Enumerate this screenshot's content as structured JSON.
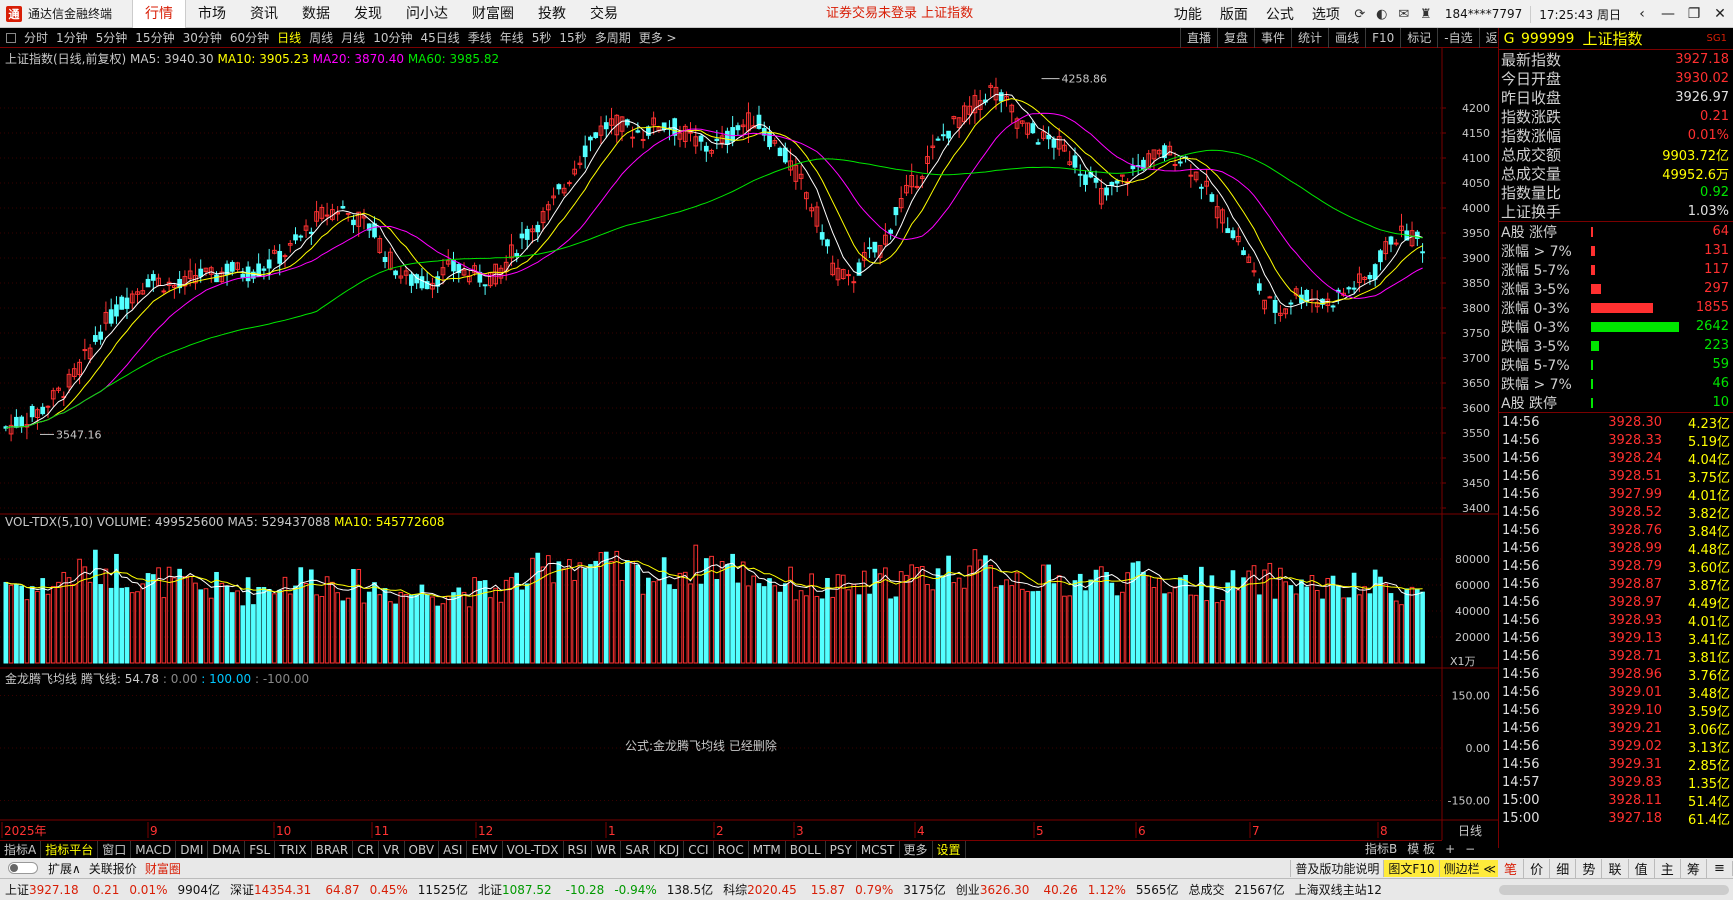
{
  "app": {
    "title": "通达信金融终端",
    "logo_glyph": "通"
  },
  "menu": [
    {
      "label": "行情",
      "active": true
    },
    {
      "label": "市场"
    },
    {
      "label": "资讯"
    },
    {
      "label": "数据"
    },
    {
      "label": "发现"
    },
    {
      "label": "问小达"
    },
    {
      "label": "财富圈"
    },
    {
      "label": "投教"
    },
    {
      "label": "交易"
    }
  ],
  "top_message": "证券交易未登录  上证指数",
  "top_right": {
    "items": [
      "功能",
      "版面",
      "公式",
      "选项"
    ],
    "account": "184****7797",
    "clock": "17:25:43 周日",
    "icons": [
      "refresh-icon",
      "user-icon",
      "message-icon",
      "shirt-icon"
    ]
  },
  "period_bar": [
    "分时",
    "1分钟",
    "5分钟",
    "15分钟",
    "30分钟",
    "60分钟",
    "日线",
    "周线",
    "月线",
    "10分钟",
    "45日线",
    "季线",
    "年线",
    "5秒",
    "15秒",
    "多周期",
    "更多 >"
  ],
  "period_active": "日线",
  "chart_buttons": [
    "直播",
    "复盘",
    "事件",
    "统计",
    "画线",
    "F10",
    "标记",
    "-自选",
    "返回"
  ],
  "legend_main": {
    "name": "上证指数(日线,前复权)",
    "ma5": "MA5: 3940.30",
    "ma10": "MA10: 3905.23",
    "ma20": "MA20: 3870.40",
    "ma60": "MA60: 3985.82"
  },
  "legend_vol": {
    "name": "VOL-TDX(5,10)",
    "volume": "VOLUME: 499525600",
    "ma5": "MA5: 529437088",
    "ma10": "MA10: 545772608"
  },
  "legend_ind": {
    "name": "金龙腾飞均线",
    "line": "腾飞线: 54.78",
    "v0": ": 0.00",
    "v1": ": 100.00",
    "v2": ": -100.00"
  },
  "indicator_message": "公式:金龙腾飞均线 已经删除",
  "annotations": {
    "high": "4258.86",
    "low": "3547.16"
  },
  "unit_label": "X1万",
  "date_labels": [
    "2025年",
    "9",
    "10",
    "11",
    "12",
    "1",
    "2",
    "3",
    "4",
    "5",
    "6",
    "7",
    "8"
  ],
  "bottom_right_label": "日线",
  "chart_data": {
    "type": "candlestick",
    "title": "上证指数(日线,前复权)",
    "y_ticks_price": [
      3400,
      3450,
      3500,
      3550,
      3600,
      3650,
      3700,
      3750,
      3800,
      3850,
      3900,
      3950,
      4000,
      4050,
      4100,
      4150,
      4200
    ],
    "y_ticks_volume": [
      20000,
      40000,
      60000,
      80000
    ],
    "y_ticks_indicator": [
      150.0,
      0.0,
      -150.0
    ],
    "high_marker": 4258.86,
    "low_marker": 3547.16,
    "close_points": [
      3560,
      3575,
      3590,
      3620,
      3650,
      3700,
      3760,
      3800,
      3830,
      3860,
      3850,
      3840,
      3870,
      3860,
      3880,
      3870,
      3880,
      3900,
      3920,
      3960,
      3990,
      4000,
      3980,
      3960,
      3900,
      3860,
      3850,
      3860,
      3880,
      3870,
      3860,
      3870,
      3920,
      3960,
      3990,
      4040,
      4100,
      4150,
      4170,
      4160,
      4150,
      4170,
      4160,
      4140,
      4120,
      4130,
      4160,
      4180,
      4140,
      4100,
      4050,
      3980,
      3880,
      3850,
      3900,
      3920,
      4000,
      4050,
      4100,
      4150,
      4180,
      4210,
      4240,
      4200,
      4160,
      4140,
      4130,
      4100,
      4060,
      4020,
      4050,
      4080,
      4100,
      4110,
      4100,
      4060,
      4000,
      3960,
      3900,
      3820,
      3790,
      3830,
      3820,
      3810,
      3830,
      3850,
      3870,
      3940,
      3950,
      3927.18
    ],
    "volume_points": [
      62000,
      58000,
      55000,
      60000,
      66000,
      68000,
      72000,
      70000,
      65000,
      60000,
      62000,
      58000,
      56000,
      57000,
      55000,
      54000,
      56000,
      60000,
      62000,
      63000,
      62000,
      60000,
      58000,
      56000,
      55000,
      52000,
      53000,
      54000,
      55000,
      54000,
      53000,
      55000,
      60000,
      65000,
      72000,
      80000,
      75000,
      72000,
      70000,
      68000,
      66000,
      65000,
      68000,
      72000,
      76000,
      74000,
      70000,
      66000,
      62000,
      60000,
      58000,
      56000,
      55000,
      56000,
      58000,
      60000,
      62000,
      64000,
      66000,
      70000,
      72000,
      70000,
      68000,
      66000,
      64000,
      62000,
      60000,
      61000,
      63000,
      64000,
      64000,
      63000,
      62000,
      61000,
      60000,
      60000,
      58000,
      58000,
      60000,
      62000,
      61000,
      60000,
      58000,
      56000,
      54000,
      56000,
      58000,
      56000,
      55000,
      51000
    ]
  },
  "quote": {
    "flag": "G",
    "code": "999999",
    "name": "上证指数",
    "tag": "SG1",
    "rows": [
      {
        "k": "最新指数",
        "v": "3927.18",
        "c": "red"
      },
      {
        "k": "今日开盘",
        "v": "3930.02",
        "c": "red"
      },
      {
        "k": "昨日收盘",
        "v": "3926.97",
        "c": "w"
      },
      {
        "k": "指数涨跌",
        "v": "0.21",
        "c": "red"
      },
      {
        "k": "指数涨幅",
        "v": "0.01%",
        "c": "red"
      },
      {
        "k": "总成交额",
        "v": "9903.72亿",
        "c": "y"
      },
      {
        "k": "总成交量",
        "v": "49952.6万",
        "c": "y"
      },
      {
        "k": "指数量比",
        "v": "0.92",
        "c": "gn"
      },
      {
        "k": "上证换手",
        "v": "1.03%",
        "c": "w"
      }
    ],
    "breadth": [
      {
        "k": "A股 涨停",
        "v": "64",
        "c": "red",
        "bar": 0.02
      },
      {
        "k": "涨幅 > 7%",
        "v": "131",
        "c": "red",
        "bar": 0.05
      },
      {
        "k": "涨幅 5-7%",
        "v": "117",
        "c": "red",
        "bar": 0.05
      },
      {
        "k": "涨幅 3-5%",
        "v": "297",
        "c": "red",
        "bar": 0.11
      },
      {
        "k": "涨幅 0-3%",
        "v": "1855",
        "c": "red",
        "bar": 0.7
      },
      {
        "k": "跌幅 0-3%",
        "v": "2642",
        "c": "green",
        "bar": 1.0
      },
      {
        "k": "跌幅 3-5%",
        "v": "223",
        "c": "green",
        "bar": 0.09
      },
      {
        "k": "跌幅 5-7%",
        "v": "59",
        "c": "green",
        "bar": 0.02
      },
      {
        "k": "跌幅 > 7%",
        "v": "46",
        "c": "green",
        "bar": 0.02
      },
      {
        "k": "A股 跌停",
        "v": "10",
        "c": "green",
        "bar": 0.0
      }
    ],
    "ticks": [
      {
        "t": "14:56",
        "p": "3928.30",
        "a": "4.23亿"
      },
      {
        "t": "14:56",
        "p": "3928.33",
        "a": "5.19亿"
      },
      {
        "t": "14:56",
        "p": "3928.24",
        "a": "4.04亿"
      },
      {
        "t": "14:56",
        "p": "3928.51",
        "a": "3.75亿"
      },
      {
        "t": "14:56",
        "p": "3927.99",
        "a": "4.01亿"
      },
      {
        "t": "14:56",
        "p": "3928.52",
        "a": "3.82亿"
      },
      {
        "t": "14:56",
        "p": "3928.76",
        "a": "3.84亿"
      },
      {
        "t": "14:56",
        "p": "3928.99",
        "a": "4.48亿"
      },
      {
        "t": "14:56",
        "p": "3928.79",
        "a": "3.60亿"
      },
      {
        "t": "14:56",
        "p": "3928.87",
        "a": "3.87亿"
      },
      {
        "t": "14:56",
        "p": "3928.97",
        "a": "4.49亿"
      },
      {
        "t": "14:56",
        "p": "3928.93",
        "a": "4.01亿"
      },
      {
        "t": "14:56",
        "p": "3929.13",
        "a": "3.41亿"
      },
      {
        "t": "14:56",
        "p": "3928.71",
        "a": "3.81亿"
      },
      {
        "t": "14:56",
        "p": "3928.96",
        "a": "3.76亿"
      },
      {
        "t": "14:56",
        "p": "3929.01",
        "a": "3.48亿"
      },
      {
        "t": "14:56",
        "p": "3929.10",
        "a": "3.59亿"
      },
      {
        "t": "14:56",
        "p": "3929.21",
        "a": "3.06亿"
      },
      {
        "t": "14:56",
        "p": "3929.02",
        "a": "3.13亿"
      },
      {
        "t": "14:56",
        "p": "3929.31",
        "a": "2.85亿"
      },
      {
        "t": "14:57",
        "p": "3929.83",
        "a": "1.35亿"
      },
      {
        "t": "15:00",
        "p": "3928.11",
        "a": "51.4亿"
      },
      {
        "t": "15:00",
        "p": "3927.18",
        "a": "61.4亿"
      }
    ]
  },
  "indicator_tabs": [
    "指标A",
    "指标平台",
    "窗口",
    "MACD",
    "DMI",
    "DMA",
    "FSL",
    "TRIX",
    "BRAR",
    "CR",
    "VR",
    "OBV",
    "ASI",
    "EMV",
    "VOL-TDX",
    "RSI",
    "WR",
    "SAR",
    "KDJ",
    "CCI",
    "ROC",
    "MTM",
    "BOLL",
    "PSY",
    "MCST",
    "更多",
    "设置"
  ],
  "indicator_tabs_right": [
    "指标B",
    "模 板",
    "+",
    "−"
  ],
  "ext_bar": {
    "items": [
      "扩展∧",
      "关联报价",
      "财富圈"
    ],
    "right": [
      "普及版功能说明",
      "图文F10",
      "侧边栏 ≪"
    ]
  },
  "right_tabs": [
    "笔",
    "价",
    "细",
    "势",
    "联",
    "值",
    "主",
    "筹",
    "≡"
  ],
  "status": [
    {
      "name": "上证",
      "price": "3927.18",
      "chg": "0.21",
      "pct": "0.01%",
      "amt": "9904亿",
      "c": "r"
    },
    {
      "name": "深证",
      "price": "14354.31",
      "chg": "64.87",
      "pct": "0.45%",
      "amt": "11525亿",
      "c": "r"
    },
    {
      "name": "北证",
      "price": "1087.52",
      "chg": "-10.28",
      "pct": "-0.94%",
      "amt": "138.5亿",
      "c": "gr"
    },
    {
      "name": "科综",
      "price": "2020.45",
      "chg": "15.87",
      "pct": "0.79%",
      "amt": "3175亿",
      "c": "r"
    },
    {
      "name": "创业",
      "price": "3626.30",
      "chg": "40.26",
      "pct": "1.12%",
      "amt": "5565亿",
      "c": "r"
    }
  ],
  "status_extra": {
    "label": "总成交",
    "value": "21567亿",
    "server": "上海双线主站12"
  }
}
